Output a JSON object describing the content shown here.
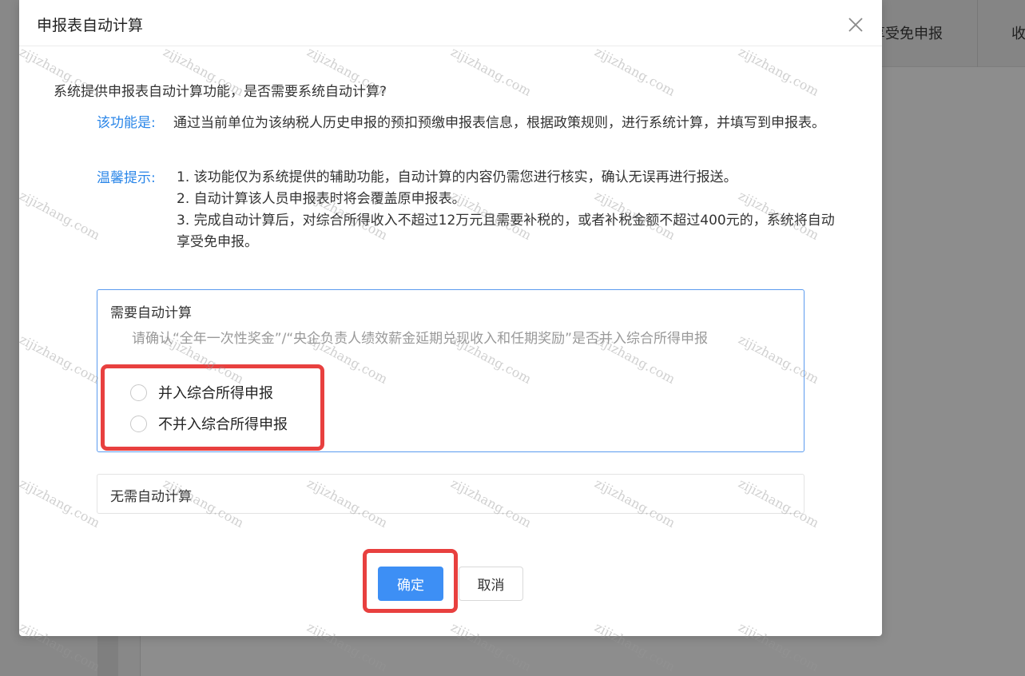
{
  "background": {
    "tabs": [
      "享受免申报",
      "收"
    ]
  },
  "dialog": {
    "title": "申报表自动计算",
    "close_icon": "close-icon",
    "question": "系统提供申报表自动计算功能，是否需要系统自动计算?",
    "feature_label": "该功能是:",
    "feature_text": "通过当前单位为该纳税人历史申报的预扣预缴申报表信息，根据政策规则，进行系统计算，并填写到申报表。",
    "tips_label": "温馨提示:",
    "tips": [
      "1. 该功能仅为系统提供的辅助功能，自动计算的内容仍需您进行核实，确认无误再进行报送。",
      "2. 自动计算该人员申报表时将会覆盖原申报表。",
      "3. 完成自动计算后，对综合所得收入不超过12万元且需要补税的，或者补税金额不超过400元的，系统将自动享受免申报。"
    ],
    "option_auto": {
      "title": "需要自动计算",
      "hint": "请确认“全年一次性奖金”/“央企负责人绩效薪金延期兑现收入和任期奖励”是否并入综合所得申报",
      "radios": [
        "并入综合所得申报",
        "不并入综合所得申报"
      ]
    },
    "option_none": {
      "title": "无需自动计算"
    },
    "confirm_label": "确定",
    "cancel_label": "取消"
  },
  "colors": {
    "accent": "#3d8ff5",
    "label_blue": "#2a86e8",
    "highlight": "#e8403f"
  },
  "watermark": "zijizhang.com"
}
